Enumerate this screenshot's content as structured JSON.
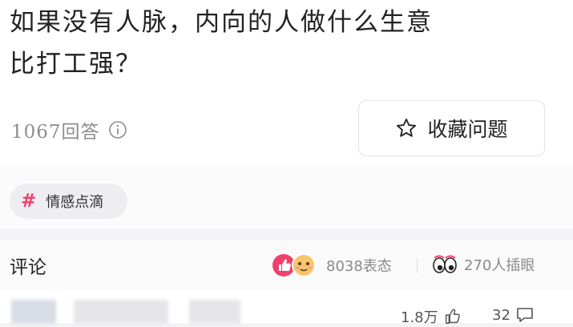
{
  "question": {
    "title": "如果没有人脉，内向的人做什么生意\n比打工强？"
  },
  "meta": {
    "answers_label": "1067回答"
  },
  "favorite_button": {
    "label": "收藏问题"
  },
  "tag": {
    "label": "情感点滴"
  },
  "comments": {
    "title": "评论",
    "reactions_label": "8038表态",
    "watching_label": "270人插眼"
  },
  "comment_row": {
    "likes": "1.8万",
    "replies": "32"
  },
  "colors": {
    "accent": "#f0406e",
    "muted": "#8a8a8a"
  }
}
